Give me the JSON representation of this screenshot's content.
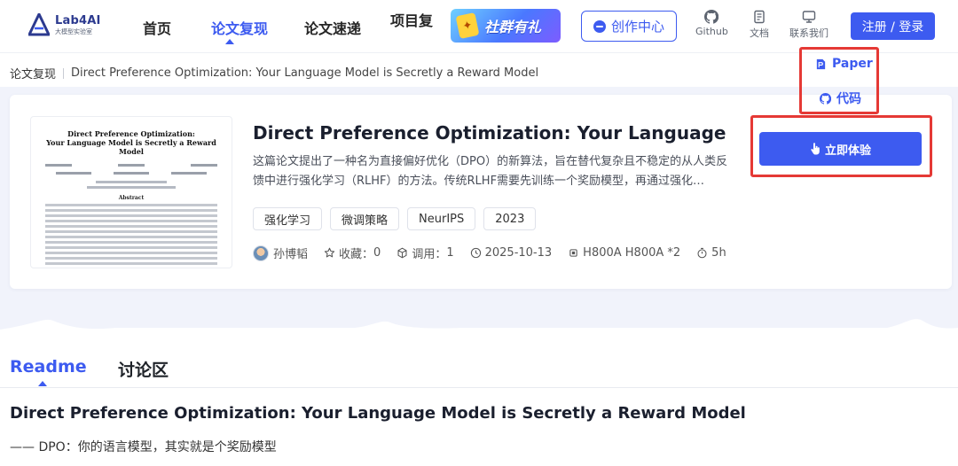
{
  "brand": {
    "name": "Lab4AI",
    "subtitle": "大模型实验室"
  },
  "nav": {
    "items": [
      "首页",
      "论文复现",
      "论文速递",
      "项目复"
    ],
    "active_index": 1
  },
  "promo": {
    "label": "社群有礼"
  },
  "create_center": {
    "label": "创作中心"
  },
  "tools": {
    "github": "Github",
    "docs": "文档",
    "contact": "联系我们"
  },
  "auth": {
    "label": "注册 / 登录"
  },
  "breadcrumb": {
    "parent": "论文复现",
    "current": "Direct Preference Optimization: Your Language Model is Secretly a Reward Model"
  },
  "paper": {
    "thumbnail_title_line1": "Direct Preference Optimization:",
    "thumbnail_title_line2": "Your Language Model is Secretly a Reward Model",
    "thumbnail_section": "Abstract",
    "title": "Direct Preference Optimization: Your Language Model...",
    "description": "这篇论文提出了一种名为直接偏好优化（DPO）的新算法，旨在替代复杂且不稳定的从人类反馈中进行强化学习（RLHF）的方法。传统RLHF需要先训练一个奖励模型，再通过强化…",
    "tags": [
      "强化学习",
      "微调策略",
      "NeurIPS",
      "2023"
    ],
    "author": "孙博韬",
    "favorites_label": "收藏：",
    "favorites": "0",
    "calls_label": "调用：",
    "calls": "1",
    "date": "2025-10-13",
    "hardware": "H800A H800A *2",
    "duration": "5h"
  },
  "links": {
    "paper": "Paper",
    "code": "代码"
  },
  "try_button": {
    "label": "立即体验"
  },
  "tabs": {
    "items": [
      "Readme",
      "讨论区"
    ],
    "active_index": 0
  },
  "readme": {
    "heading": "Direct Preference Optimization: Your Language Model is Secretly a Reward Model",
    "subheading": "—— DPO：你的语言模型，其实就是个奖励模型"
  },
  "colors": {
    "accent": "#3d5bf0",
    "highlight_border": "#e53935",
    "hero_bg": "#f1f3fb"
  }
}
